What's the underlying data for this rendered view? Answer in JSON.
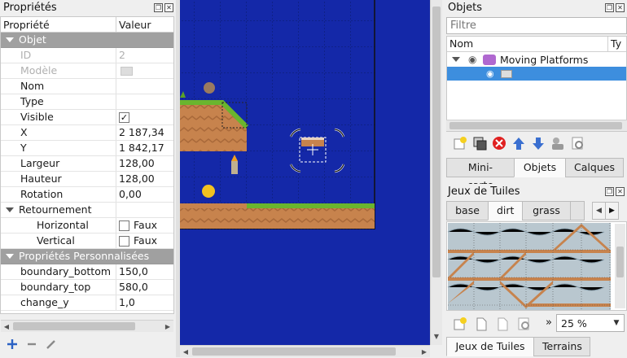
{
  "properties": {
    "title": "Propriétés",
    "col_property": "Propriété",
    "col_value": "Valeur",
    "rows": [
      {
        "name": "Objet",
        "value": "",
        "kind": "group"
      },
      {
        "name": "ID",
        "value": "2",
        "kind": "disabled"
      },
      {
        "name": "Modèle",
        "value": "",
        "kind": "disabled-template"
      },
      {
        "name": "Nom",
        "value": "",
        "kind": "plain"
      },
      {
        "name": "Type",
        "value": "",
        "kind": "plain"
      },
      {
        "name": "Visible",
        "value": "✓",
        "kind": "check"
      },
      {
        "name": "X",
        "value": "2 187,34",
        "kind": "plain"
      },
      {
        "name": "Y",
        "value": "1 842,17",
        "kind": "plain"
      },
      {
        "name": "Largeur",
        "value": "128,00",
        "kind": "plain"
      },
      {
        "name": "Hauteur",
        "value": "128,00",
        "kind": "plain"
      },
      {
        "name": "Rotation",
        "value": "0,00",
        "kind": "plain"
      },
      {
        "name": "Retournement",
        "value": "",
        "kind": "subgroup"
      },
      {
        "name": "Horizontal",
        "value": "Faux",
        "kind": "checkbox-false"
      },
      {
        "name": "Vertical",
        "value": "Faux",
        "kind": "checkbox-false"
      },
      {
        "name": "Propriétés Personnalisées",
        "value": "",
        "kind": "group"
      },
      {
        "name": "boundary_bottom",
        "value": "150,0",
        "kind": "plain"
      },
      {
        "name": "boundary_top",
        "value": "580,0",
        "kind": "plain"
      },
      {
        "name": "change_y",
        "value": "1,0",
        "kind": "plain"
      }
    ],
    "footer_icons": [
      "add-icon",
      "remove-icon",
      "edit-icon"
    ]
  },
  "objects": {
    "title": "Objets",
    "filter_placeholder": "Filtre",
    "col_name": "Nom",
    "col_type": "Ty",
    "layer_name": "Moving Platforms",
    "toolbar_icons": [
      "new-layer-icon",
      "duplicate-icon",
      "delete-icon",
      "move-up-icon",
      "move-down-icon",
      "group-icon",
      "properties-icon"
    ],
    "tabs": [
      "Mini-carte",
      "Objets",
      "Calques"
    ],
    "active_tab": "Objets"
  },
  "tilesets": {
    "title": "Jeux de Tuiles",
    "tabs": [
      "base",
      "dirt",
      "grass"
    ],
    "active_tab": "dirt",
    "zoom_prefix": "»",
    "zoom": "25 %",
    "bottom_tabs": [
      "Jeux de Tuiles",
      "Terrains"
    ],
    "active_bottom_tab": "Jeux de Tuiles"
  },
  "colors": {
    "map_background": "#1428a8",
    "selection": "#3d8ede",
    "group_row": "#a0a0a0",
    "grass": "#6ab52e",
    "dirt": "#c47a45"
  }
}
